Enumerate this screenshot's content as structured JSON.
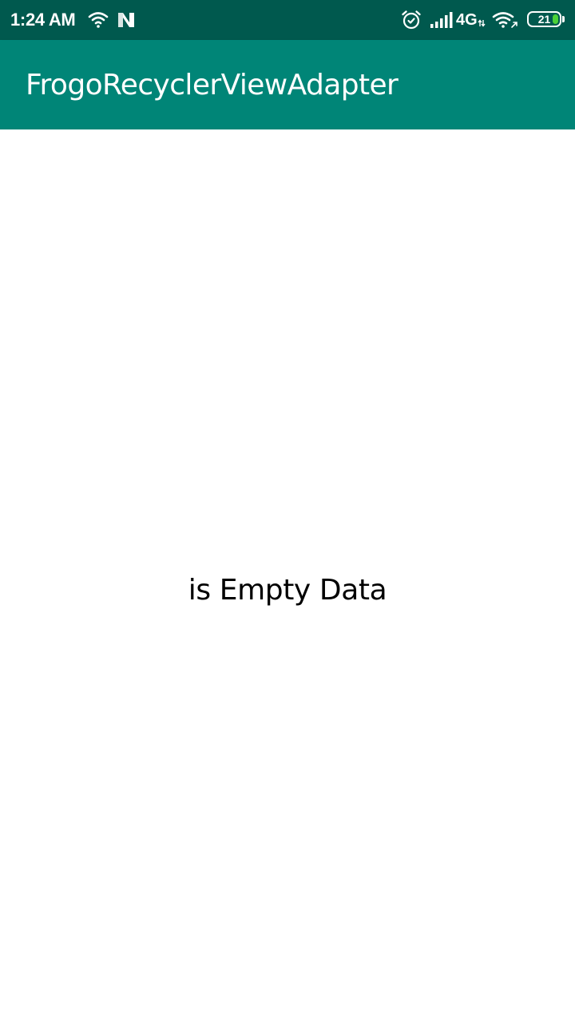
{
  "status_bar": {
    "time": "1:24 AM",
    "network_type": "4G",
    "battery_level": "21",
    "battery_fraction": 0.21,
    "icons": [
      "wifi-icon",
      "n-notification-icon",
      "alarm-icon",
      "signal-icon",
      "wifi-icon",
      "battery-icon"
    ],
    "colors": {
      "background": "#00594e",
      "battery_fill": "#4cd137"
    }
  },
  "app_bar": {
    "title": "FrogoRecyclerViewAdapter",
    "color": "#008577"
  },
  "main": {
    "empty_message": "is Empty Data"
  }
}
